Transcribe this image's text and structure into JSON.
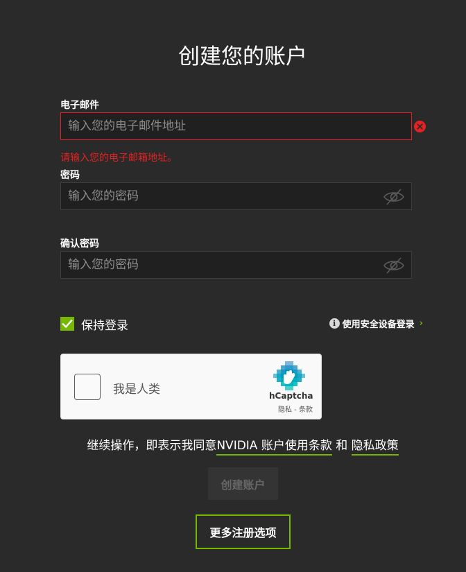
{
  "title": "创建您的账户",
  "email": {
    "label": "电子邮件",
    "placeholder": "输入您的电子邮件地址",
    "value": "",
    "error": "请输入您的电子邮箱地址。"
  },
  "password": {
    "label": "密码",
    "placeholder": "输入您的密码",
    "value": ""
  },
  "confirm_password": {
    "label": "确认密码",
    "placeholder": "输入您的密码",
    "value": ""
  },
  "keep_signed_in": {
    "label": "保持登录",
    "checked": true
  },
  "device_login": {
    "label": "使用安全设备登录",
    "icon": "info-icon"
  },
  "captcha": {
    "label": "我是人类",
    "brand": "hCaptcha",
    "privacy": "隐私",
    "separator": " - ",
    "terms": "条款"
  },
  "terms_text": {
    "prefix": "继续操作，即表示我同意",
    "terms_link": "NVIDIA 账户使用条款",
    "and": " 和 ",
    "privacy_link": "隐私政策"
  },
  "buttons": {
    "create": "创建账户",
    "more_options": "更多注册选项"
  },
  "colors": {
    "background": "#2a2a2a",
    "accent": "#76b900",
    "error": "#e52222"
  }
}
